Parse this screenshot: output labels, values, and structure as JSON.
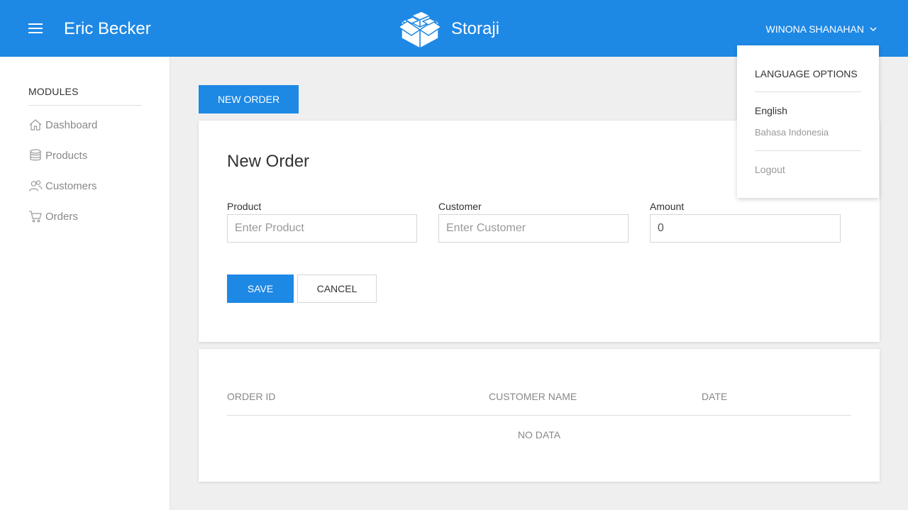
{
  "header": {
    "menu_icon": "hamburger-menu-icon",
    "left_title": "Eric Becker",
    "brand_name": "Storaji",
    "brand_logo": "boxes-logo",
    "user_name": "WINONA SHANAHAN",
    "user_chevron": "chevron-down-icon",
    "accent_color": "#1e88e5"
  },
  "sidebar": {
    "title": "MODULES",
    "items": [
      {
        "label": "Dashboard",
        "icon": "home-icon"
      },
      {
        "label": "Products",
        "icon": "database-icon"
      },
      {
        "label": "Customers",
        "icon": "users-icon"
      },
      {
        "label": "Orders",
        "icon": "cart-icon"
      }
    ]
  },
  "toolbar": {
    "new_order_label": "NEW ORDER"
  },
  "form": {
    "title": "New Order",
    "product": {
      "label": "Product",
      "placeholder": "Enter Product",
      "value": ""
    },
    "customer": {
      "label": "Customer",
      "placeholder": "Enter Customer",
      "value": ""
    },
    "amount": {
      "label": "Amount",
      "value": "0"
    },
    "save_label": "SAVE",
    "cancel_label": "CANCEL"
  },
  "table": {
    "columns": [
      "ORDER ID",
      "CUSTOMER NAME",
      "DATE"
    ],
    "empty_text": "NO DATA"
  },
  "dropdown": {
    "title": "LANGUAGE OPTIONS",
    "languages": [
      {
        "label": "English",
        "selected": true
      },
      {
        "label": "Bahasa Indonesia",
        "selected": false
      }
    ],
    "logout_label": "Logout"
  }
}
